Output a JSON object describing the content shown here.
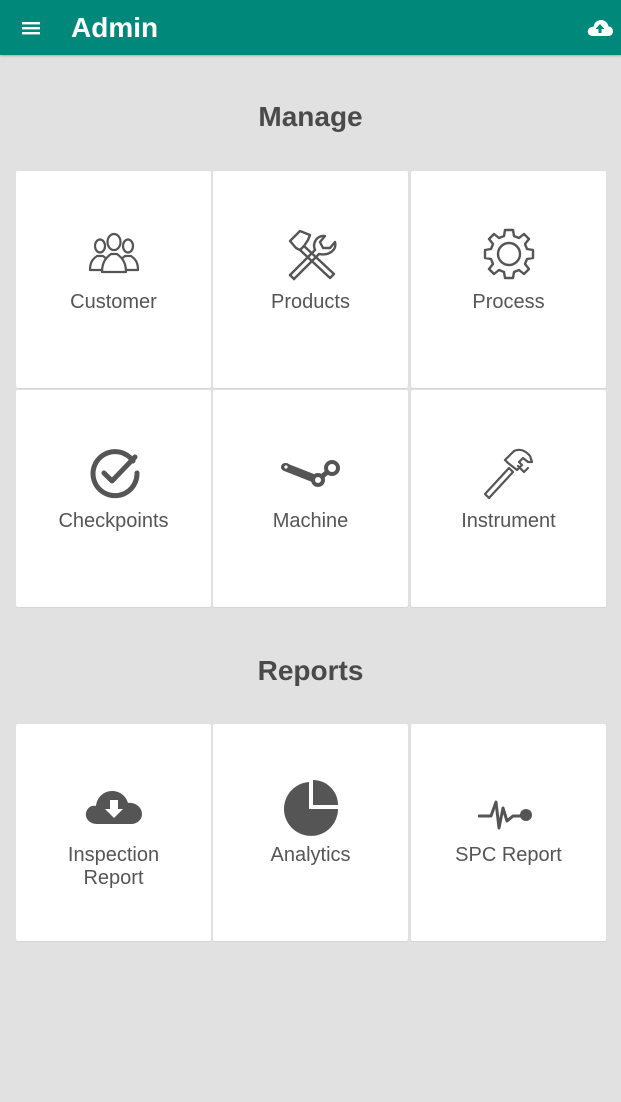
{
  "header": {
    "title": "Admin",
    "menu_icon": "menu-icon",
    "action_icon": "cloud-upload-icon"
  },
  "colors": {
    "app_bar": "#00897b",
    "background": "#e1e1e1",
    "tile": "#ffffff",
    "icon": "#555555",
    "text": "#555555",
    "heading": "#4a4a4a"
  },
  "manage": {
    "title": "Manage",
    "tiles": [
      {
        "label": "Customer",
        "icon": "users-icon"
      },
      {
        "label": "Products",
        "icon": "tools-icon"
      },
      {
        "label": "Process",
        "icon": "gear-icon"
      },
      {
        "label": "Checkpoints",
        "icon": "check-circle-icon"
      },
      {
        "label": "Machine",
        "icon": "steam-icon"
      },
      {
        "label": "Instrument",
        "icon": "hammer-icon"
      }
    ]
  },
  "reports": {
    "title": "Reports",
    "tiles": [
      {
        "label": "Inspection\nReport",
        "icon": "cloud-download-icon"
      },
      {
        "label": "Analytics",
        "icon": "pie-chart-icon"
      },
      {
        "label": "SPC Report",
        "icon": "pulse-icon"
      }
    ]
  }
}
